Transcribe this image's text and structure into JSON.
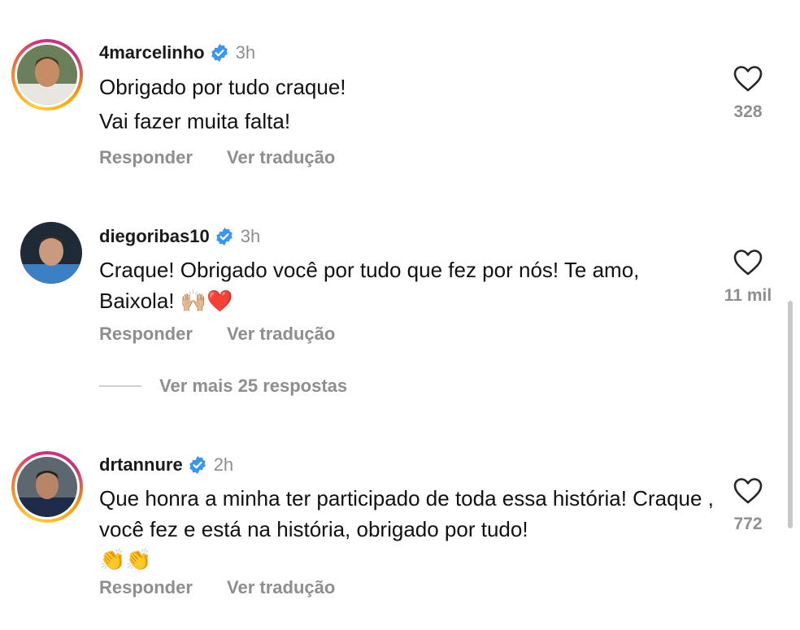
{
  "comments": [
    {
      "username": "4marcelinho",
      "time": "3h",
      "lines": [
        "Obrigado por tudo craque!",
        "Vai fazer muita falta!"
      ],
      "likes": "328",
      "reply": "Responder",
      "translate": "Ver tradução"
    },
    {
      "username": "diegoribas10",
      "time": "3h",
      "text": "Craque! Obrigado você por tudo que fez por nós! Te amo, Baixola! 🙌🏼❤️",
      "likes": "11 mil",
      "reply": "Responder",
      "translate": "Ver tradução",
      "view_more": "Ver mais 25 respostas"
    },
    {
      "username": "drtannure",
      "time": "2h",
      "text": "Que honra a minha ter participado de toda essa história! Craque , você fez e está na história, obrigado por tudo!",
      "emoji_line": "👏👏",
      "likes": "772",
      "reply": "Responder",
      "translate": "Ver tradução"
    }
  ],
  "colors": {
    "verified": "#3897f0",
    "muted": "#8e8e8e"
  },
  "icons": [
    "heart-icon",
    "verified-icon"
  ]
}
